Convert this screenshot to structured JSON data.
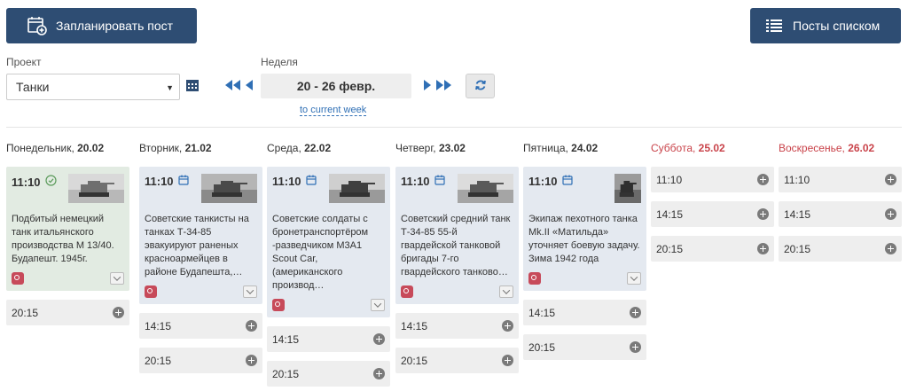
{
  "toolbar": {
    "plan_label": "Запланировать пост",
    "list_label": "Посты списком"
  },
  "filters": {
    "project_label": "Проект",
    "project_value": "Танки",
    "week_label": "Неделя",
    "week_value": "20 - 26 февр.",
    "to_current": "to current week"
  },
  "colors": {
    "primary": "#2e4d73",
    "accent": "#2f6fb5",
    "weekend": "#c9434a",
    "published_bg": "#e2ebe2",
    "planned_bg": "#e4e9f0",
    "slot_bg": "#eeeeee"
  },
  "days": [
    {
      "weekday": "Понедельник",
      "date": "20.02",
      "weekend": false,
      "posts": [
        {
          "time": "11:10",
          "status": "published",
          "status_icon": "check-circle-icon",
          "text": "Подбитый немецкий танк итальянского производства М 13/40. Будапешт. 1945г.",
          "network": "instagram-icon"
        }
      ],
      "slots": [
        "20:15"
      ]
    },
    {
      "weekday": "Вторник",
      "date": "21.02",
      "weekend": false,
      "posts": [
        {
          "time": "11:10",
          "status": "planned",
          "status_icon": "calendar-icon",
          "text": "Советские танкисты на танках Т-34-85 эвакуируют раненых красноармейцев в районе Будапешта,…",
          "network": "instagram-icon"
        }
      ],
      "slots": [
        "14:15",
        "20:15"
      ]
    },
    {
      "weekday": "Среда",
      "date": "22.02",
      "weekend": false,
      "posts": [
        {
          "time": "11:10",
          "status": "planned",
          "status_icon": "calendar-icon",
          "text": "Советские солдаты с бронетранспортёром -разведчиком M3A1 Scout Car, (американского производ…",
          "network": "instagram-icon"
        }
      ],
      "slots": [
        "14:15",
        "20:15"
      ]
    },
    {
      "weekday": "Четверг",
      "date": "23.02",
      "weekend": false,
      "posts": [
        {
          "time": "11:10",
          "status": "planned",
          "status_icon": "calendar-icon",
          "text": "Советский средний танк Т-34-85 55-й гвардейской танковой бригады 7-го гвардейского танково…",
          "network": "instagram-icon"
        }
      ],
      "slots": [
        "14:15",
        "20:15"
      ]
    },
    {
      "weekday": "Пятница",
      "date": "24.02",
      "weekend": false,
      "posts": [
        {
          "time": "11:10",
          "status": "planned",
          "status_icon": "calendar-icon",
          "text": "Экипаж пехотного танка Mk.II «Матильда» уточняет боевую задачу. Зима 1942 года",
          "network": "instagram-icon"
        }
      ],
      "slots": [
        "14:15",
        "20:15"
      ]
    },
    {
      "weekday": "Суббота",
      "date": "25.02",
      "weekend": true,
      "posts": [],
      "slots": [
        "11:10",
        "14:15",
        "20:15"
      ]
    },
    {
      "weekday": "Воскресенье",
      "date": "26.02",
      "weekend": true,
      "posts": [],
      "slots": [
        "11:10",
        "14:15",
        "20:15"
      ]
    }
  ]
}
